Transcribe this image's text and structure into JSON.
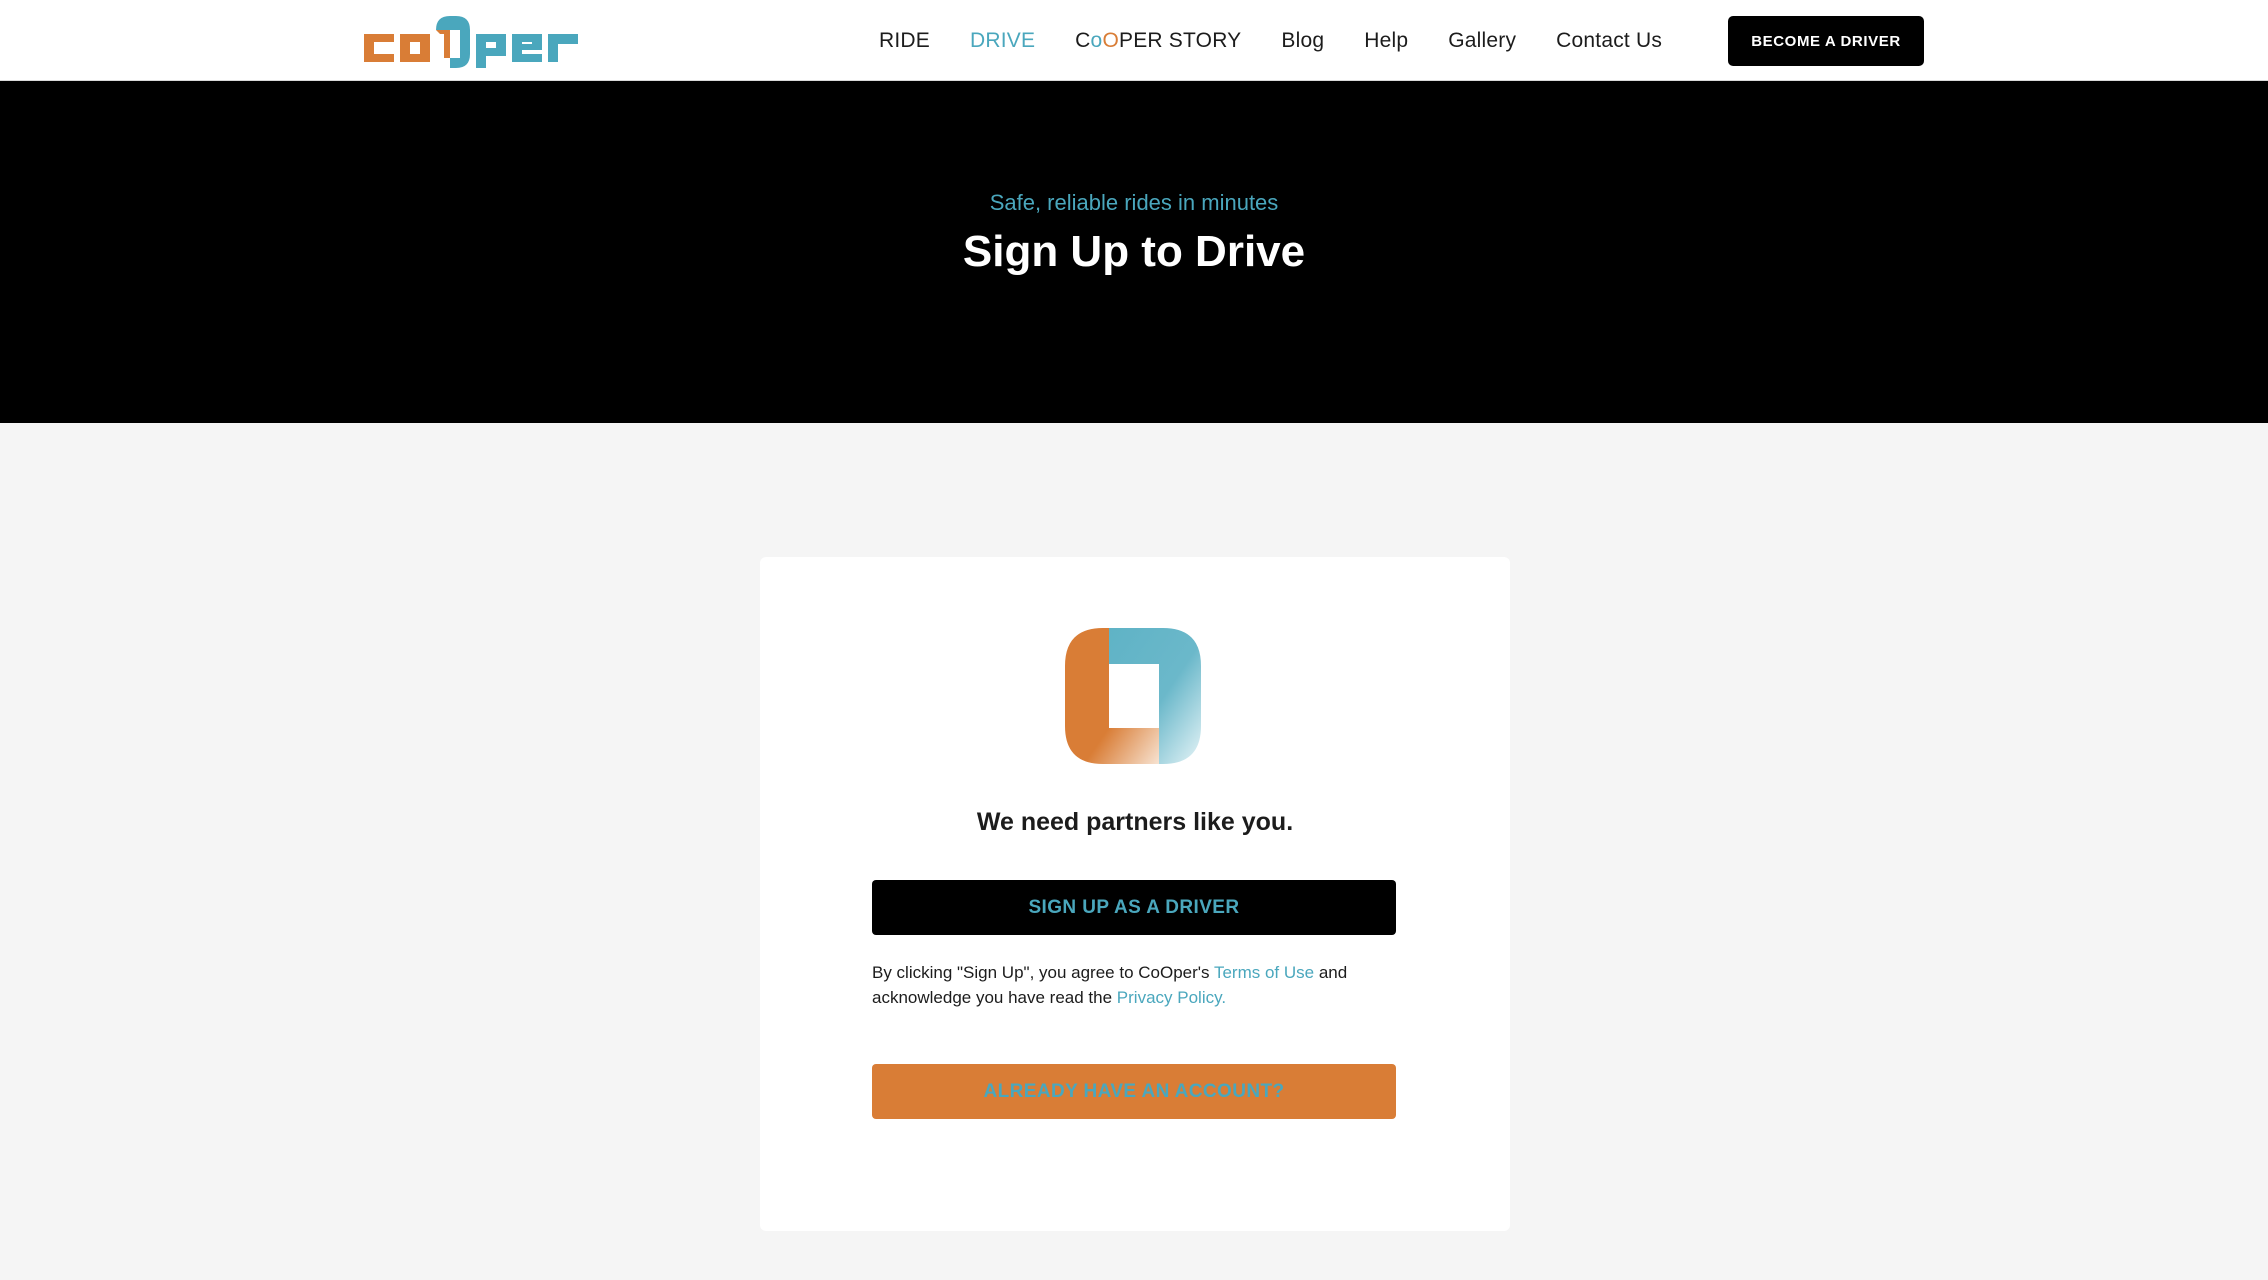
{
  "brand": {
    "logo_text": "coOper",
    "orange": "#d97d36",
    "teal": "#4aa7bd"
  },
  "nav": {
    "items": [
      {
        "label": "RIDE",
        "active": false
      },
      {
        "label": "DRIVE",
        "active": true
      },
      {
        "label_prefix": "C",
        "label_o1": "o",
        "label_o2": "O",
        "label_suffix": "PER STORY",
        "active": false
      },
      {
        "label": "Blog",
        "active": false
      },
      {
        "label": "Help",
        "active": false
      },
      {
        "label": "Gallery",
        "active": false
      },
      {
        "label": "Contact Us",
        "active": false
      }
    ],
    "cta_label": "BECOME A DRIVER"
  },
  "hero": {
    "subtitle": "Safe, reliable rides in minutes",
    "title": "Sign Up to Drive"
  },
  "card": {
    "icon": "cooper-app-icon",
    "heading": "We need partners like you.",
    "signup_label": "SIGN UP AS A DRIVER",
    "terms_part1": "By clicking \"Sign Up\", you agree to CoOper's ",
    "terms_link": "Terms of Use",
    "terms_part2": " and acknowledge you have read the ",
    "privacy_link": "Privacy Policy.",
    "account_label": "ALREADY HAVE AN ACCOUNT?"
  }
}
